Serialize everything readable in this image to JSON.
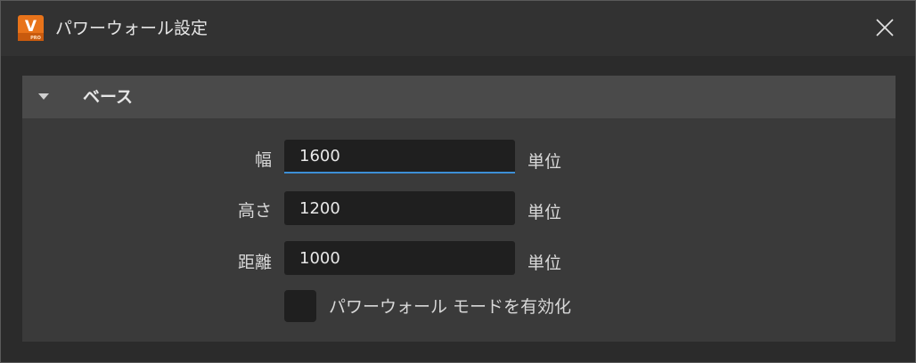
{
  "window": {
    "title": "パワーウォール設定",
    "app_icon": "v-app-icon",
    "app_icon_letter": "V",
    "app_icon_sub": "PRO",
    "close_icon": "close-icon"
  },
  "colors": {
    "accent": "#3d8fd6",
    "app_icon": "#e8731a"
  },
  "section": {
    "title": "ベース",
    "expanded": true,
    "toggle_icon": "triangle-down-icon"
  },
  "fields": [
    {
      "label": "幅",
      "value": "1600",
      "unit": "単位",
      "focused": true
    },
    {
      "label": "高さ",
      "value": "1200",
      "unit": "単位",
      "focused": false
    },
    {
      "label": "距離",
      "value": "1000",
      "unit": "単位",
      "focused": false
    }
  ],
  "powerwall_mode": {
    "label": "パワーウォール モードを有効化",
    "checked": false
  }
}
